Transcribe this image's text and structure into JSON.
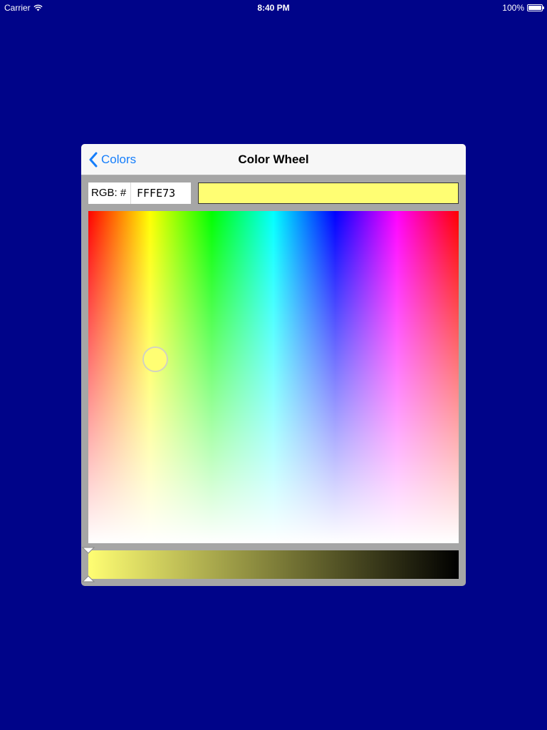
{
  "status_bar": {
    "carrier": "Carrier",
    "time": "8:40 PM",
    "battery": "100%",
    "wifi_icon": "wifi-icon",
    "battery_icon": "battery-icon"
  },
  "nav": {
    "back_label": "Colors",
    "back_icon": "chevron-left-icon",
    "title": "Color Wheel"
  },
  "color_picker": {
    "rgb_label": "RGB: #",
    "hex_value": "FFFE73",
    "selected_color": "#fffe73",
    "brightness": 1.0
  },
  "colors": {
    "background": "#000489",
    "panel": "#a6a6a6",
    "nav_bar": "#f7f7f7",
    "accent": "#157efb"
  }
}
